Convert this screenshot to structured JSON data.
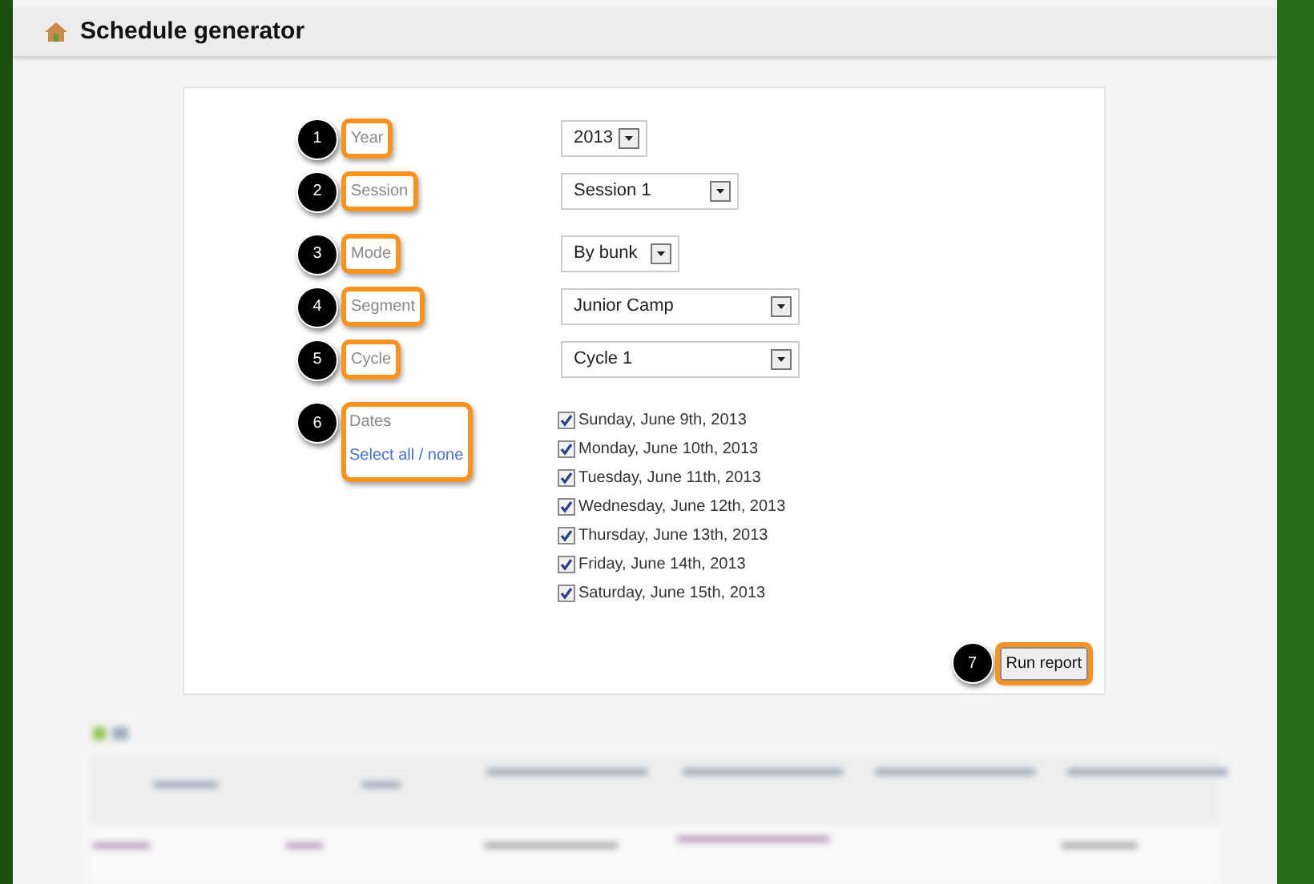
{
  "header": {
    "title": "Schedule generator"
  },
  "field_groups": [
    [
      {
        "kind": "select",
        "callout": "1",
        "label": "Year",
        "value": "2013"
      },
      {
        "kind": "select",
        "callout": "2",
        "label": "Session",
        "value": "Session 1"
      }
    ],
    [
      {
        "kind": "select",
        "callout": "3",
        "label": "Mode",
        "value": "By bunk"
      },
      {
        "kind": "select",
        "callout": "4",
        "label": "Segment",
        "value": "Junior Camp"
      },
      {
        "kind": "select",
        "callout": "5",
        "label": "Cycle",
        "value": "Cycle 1"
      }
    ]
  ],
  "dates": {
    "callout": "6",
    "label": "Dates",
    "link": "Select all / none",
    "options": [
      {
        "label": "Sunday, June 9th, 2013",
        "checked": true
      },
      {
        "label": "Monday, June 10th, 2013",
        "checked": true
      },
      {
        "label": "Tuesday, June 11th, 2013",
        "checked": true
      },
      {
        "label": "Wednesday, June 12th, 2013",
        "checked": true
      },
      {
        "label": "Thursday, June 13th, 2013",
        "checked": true
      },
      {
        "label": "Friday, June 14th, 2013",
        "checked": true
      },
      {
        "label": "Saturday, June 15th, 2013",
        "checked": true
      }
    ]
  },
  "run_button": {
    "callout": "7",
    "label": "Run report"
  }
}
